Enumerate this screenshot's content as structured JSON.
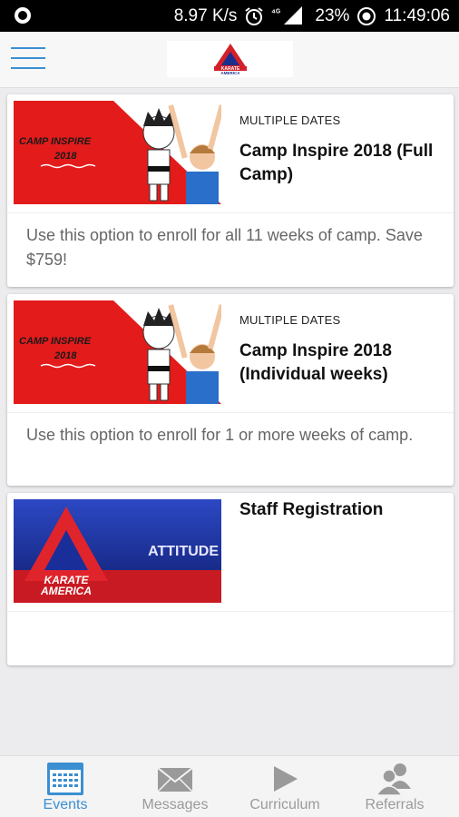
{
  "status_bar": {
    "speed": "8.97 K/s",
    "network": "4G",
    "battery": "23%",
    "time": "11:49:06"
  },
  "header": {
    "logo_text_1": "KARATE",
    "logo_text_2": "AMERICA"
  },
  "events": [
    {
      "dates": "MULTIPLE DATES",
      "title": "Camp Inspire 2018 (Full Camp)",
      "description": "Use this option to enroll for all 11 weeks of camp. Save $759!",
      "banner_line1": "CAMP INSPIRE",
      "banner_line2": "2018"
    },
    {
      "dates": "MULTIPLE DATES",
      "title": "Camp Inspire 2018 (Individual weeks)",
      "description": "Use this option to enroll for 1 or more weeks of camp.",
      "banner_line1": "CAMP INSPIRE",
      "banner_line2": "2018"
    },
    {
      "dates": "",
      "title": "Staff Registration",
      "description": "",
      "banner_word": "ATTITUDE",
      "banner_logo_1": "KARATE",
      "banner_logo_2": "AMERICA"
    }
  ],
  "tabs": [
    {
      "label": "Events",
      "icon": "calendar-icon",
      "active": true
    },
    {
      "label": "Messages",
      "icon": "envelope-icon",
      "active": false
    },
    {
      "label": "Curriculum",
      "icon": "play-icon",
      "active": false
    },
    {
      "label": "Referrals",
      "icon": "people-icon",
      "active": false
    }
  ],
  "colors": {
    "accent": "#3b8fd1",
    "banner_red": "#e31b1b",
    "staff_blue": "#1a2e9a"
  }
}
